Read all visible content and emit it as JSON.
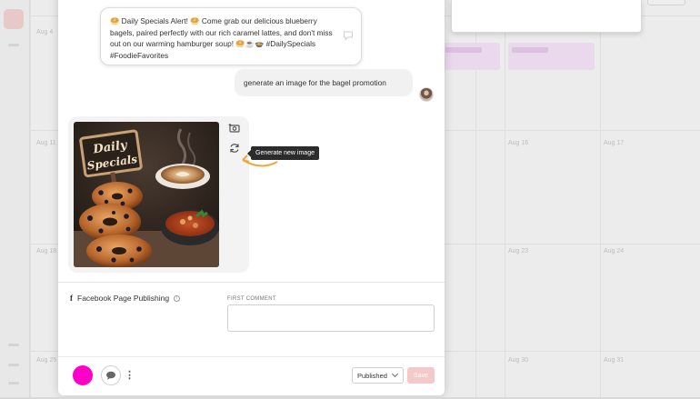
{
  "calendar": {
    "dates": [
      "Aug 4",
      "Aug 11",
      "Aug 16",
      "Aug 17",
      "Aug 18",
      "Aug 23",
      "Aug 24",
      "Aug 25",
      "Aug 30",
      "Aug 31"
    ]
  },
  "chat": {
    "ai_message": "🥯 Daily Specials Alert! 🥯 Come grab our delicious blueberry bagels, paired perfectly with our rich caramel lattes, and don't miss out on our warming hamburger soup! 🥯☕🍲 #DailySpecials #FoodieFavorites",
    "user_message": "generate an image for the bagel promotion",
    "image_sign_text": "Daily Specials",
    "tooltip": "Generate new image"
  },
  "publishing": {
    "platform_label": "Facebook Page Publishing",
    "platform_icon": "f",
    "info_icon": "i",
    "first_comment_label": "FIRST COMMENT",
    "first_comment_value": ""
  },
  "footer": {
    "kebab": "⋮",
    "status_value": "Published",
    "save_label": "Save",
    "color": "#ff00c8"
  }
}
